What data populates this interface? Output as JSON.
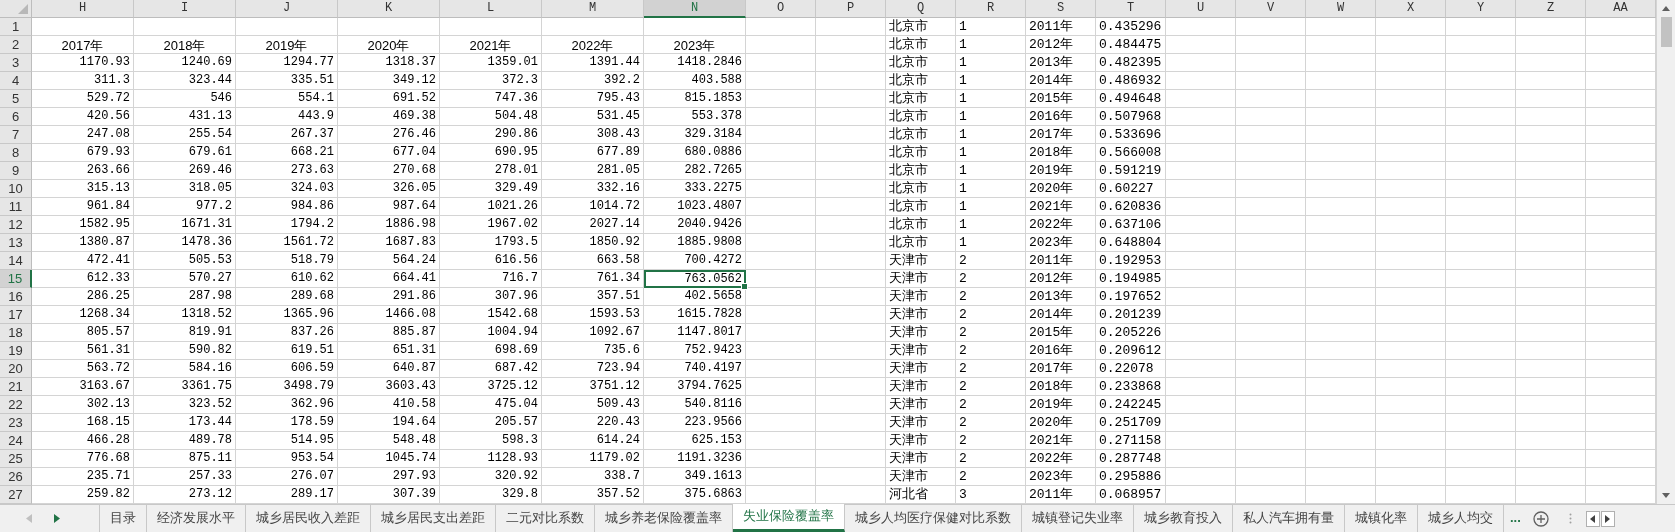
{
  "columns": [
    {
      "label": "H",
      "selected": false
    },
    {
      "label": "I",
      "selected": false
    },
    {
      "label": "J",
      "selected": false
    },
    {
      "label": "K",
      "selected": false
    },
    {
      "label": "L",
      "selected": false
    },
    {
      "label": "M",
      "selected": false
    },
    {
      "label": "N",
      "selected": true
    },
    {
      "label": "O",
      "selected": false
    },
    {
      "label": "P",
      "selected": false
    },
    {
      "label": "Q",
      "selected": false
    },
    {
      "label": "R",
      "selected": false
    },
    {
      "label": "S",
      "selected": false
    },
    {
      "label": "T",
      "selected": false
    },
    {
      "label": "U",
      "selected": false
    },
    {
      "label": "V",
      "selected": false
    },
    {
      "label": "W",
      "selected": false
    },
    {
      "label": "X",
      "selected": false
    },
    {
      "label": "Y",
      "selected": false
    },
    {
      "label": "Z",
      "selected": false
    },
    {
      "label": "AA",
      "selected": false
    }
  ],
  "rows": [
    {
      "number": "1",
      "selected": false,
      "right_cells": [
        "北京市",
        "1",
        "2011年",
        "0.435296"
      ]
    },
    {
      "number": "2",
      "selected": false,
      "kind": "label",
      "left_cells": [
        "2017年",
        "2018年",
        "2019年",
        "2020年",
        "2021年",
        "2022年",
        "2023年"
      ],
      "right_cells": [
        "北京市",
        "1",
        "2012年",
        "0.484475"
      ]
    },
    {
      "number": "3",
      "selected": false,
      "left_cells": [
        "1170.93",
        "1240.69",
        "1294.77",
        "1318.37",
        "1359.01",
        "1391.44",
        "1418.2846"
      ],
      "right_cells": [
        "北京市",
        "1",
        "2013年",
        "0.482395"
      ]
    },
    {
      "number": "4",
      "selected": false,
      "left_cells": [
        "311.3",
        "323.44",
        "335.51",
        "349.12",
        "372.3",
        "392.2",
        "403.588"
      ],
      "right_cells": [
        "北京市",
        "1",
        "2014年",
        "0.486932"
      ]
    },
    {
      "number": "5",
      "selected": false,
      "left_cells": [
        "529.72",
        "546",
        "554.1",
        "691.52",
        "747.36",
        "795.43",
        "815.1853"
      ],
      "right_cells": [
        "北京市",
        "1",
        "2015年",
        "0.494648"
      ]
    },
    {
      "number": "6",
      "selected": false,
      "left_cells": [
        "420.56",
        "431.13",
        "443.9",
        "469.38",
        "504.48",
        "531.45",
        "553.378"
      ],
      "right_cells": [
        "北京市",
        "1",
        "2016年",
        "0.507968"
      ]
    },
    {
      "number": "7",
      "selected": false,
      "left_cells": [
        "247.08",
        "255.54",
        "267.37",
        "276.46",
        "290.86",
        "308.43",
        "329.3184"
      ],
      "right_cells": [
        "北京市",
        "1",
        "2017年",
        "0.533696"
      ]
    },
    {
      "number": "8",
      "selected": false,
      "left_cells": [
        "679.93",
        "679.61",
        "668.21",
        "677.04",
        "690.95",
        "677.89",
        "680.0886"
      ],
      "right_cells": [
        "北京市",
        "1",
        "2018年",
        "0.566008"
      ]
    },
    {
      "number": "9",
      "selected": false,
      "left_cells": [
        "263.66",
        "269.46",
        "273.63",
        "270.68",
        "278.01",
        "281.05",
        "282.7265"
      ],
      "right_cells": [
        "北京市",
        "1",
        "2019年",
        "0.591219"
      ]
    },
    {
      "number": "10",
      "selected": false,
      "left_cells": [
        "315.13",
        "318.05",
        "324.03",
        "326.05",
        "329.49",
        "332.16",
        "333.2275"
      ],
      "right_cells": [
        "北京市",
        "1",
        "2020年",
        "0.60227"
      ]
    },
    {
      "number": "11",
      "selected": false,
      "left_cells": [
        "961.84",
        "977.2",
        "984.86",
        "987.64",
        "1021.26",
        "1014.72",
        "1023.4807"
      ],
      "right_cells": [
        "北京市",
        "1",
        "2021年",
        "0.620836"
      ]
    },
    {
      "number": "12",
      "selected": false,
      "left_cells": [
        "1582.95",
        "1671.31",
        "1794.2",
        "1886.98",
        "1967.02",
        "2027.14",
        "2040.9426"
      ],
      "right_cells": [
        "北京市",
        "1",
        "2022年",
        "0.637106"
      ]
    },
    {
      "number": "13",
      "selected": false,
      "left_cells": [
        "1380.87",
        "1478.36",
        "1561.72",
        "1687.83",
        "1793.5",
        "1850.92",
        "1885.9808"
      ],
      "right_cells": [
        "北京市",
        "1",
        "2023年",
        "0.648804"
      ]
    },
    {
      "number": "14",
      "selected": false,
      "left_cells": [
        "472.41",
        "505.53",
        "518.79",
        "564.24",
        "616.56",
        "663.58",
        "700.4272"
      ],
      "right_cells": [
        "天津市",
        "2",
        "2011年",
        "0.192953"
      ]
    },
    {
      "number": "15",
      "selected": true,
      "left_cells": [
        "612.33",
        "570.27",
        "610.62",
        "664.41",
        "716.7",
        "761.34",
        "763.0562"
      ],
      "right_cells": [
        "天津市",
        "2",
        "2012年",
        "0.194985"
      ]
    },
    {
      "number": "16",
      "selected": false,
      "left_cells": [
        "286.25",
        "287.98",
        "289.68",
        "291.86",
        "307.96",
        "357.51",
        "402.5658"
      ],
      "right_cells": [
        "天津市",
        "2",
        "2013年",
        "0.197652"
      ]
    },
    {
      "number": "17",
      "selected": false,
      "left_cells": [
        "1268.34",
        "1318.52",
        "1365.96",
        "1466.08",
        "1542.68",
        "1593.53",
        "1615.7828"
      ],
      "right_cells": [
        "天津市",
        "2",
        "2014年",
        "0.201239"
      ]
    },
    {
      "number": "18",
      "selected": false,
      "left_cells": [
        "805.57",
        "819.91",
        "837.26",
        "885.87",
        "1004.94",
        "1092.67",
        "1147.8017"
      ],
      "right_cells": [
        "天津市",
        "2",
        "2015年",
        "0.205226"
      ]
    },
    {
      "number": "19",
      "selected": false,
      "left_cells": [
        "561.31",
        "590.82",
        "619.51",
        "651.31",
        "698.69",
        "735.6",
        "752.9423"
      ],
      "right_cells": [
        "天津市",
        "2",
        "2016年",
        "0.209612"
      ]
    },
    {
      "number": "20",
      "selected": false,
      "left_cells": [
        "563.72",
        "584.16",
        "606.59",
        "640.87",
        "687.42",
        "723.94",
        "740.4197"
      ],
      "right_cells": [
        "天津市",
        "2",
        "2017年",
        "0.22078"
      ]
    },
    {
      "number": "21",
      "selected": false,
      "left_cells": [
        "3163.67",
        "3361.75",
        "3498.79",
        "3603.43",
        "3725.12",
        "3751.12",
        "3794.7625"
      ],
      "right_cells": [
        "天津市",
        "2",
        "2018年",
        "0.233868"
      ]
    },
    {
      "number": "22",
      "selected": false,
      "left_cells": [
        "302.13",
        "323.52",
        "362.96",
        "410.58",
        "475.04",
        "509.43",
        "540.8116"
      ],
      "right_cells": [
        "天津市",
        "2",
        "2019年",
        "0.242245"
      ]
    },
    {
      "number": "23",
      "selected": false,
      "left_cells": [
        "168.15",
        "173.44",
        "178.59",
        "194.64",
        "205.57",
        "220.43",
        "223.9566"
      ],
      "right_cells": [
        "天津市",
        "2",
        "2020年",
        "0.251709"
      ]
    },
    {
      "number": "24",
      "selected": false,
      "left_cells": [
        "466.28",
        "489.78",
        "514.95",
        "548.48",
        "598.3",
        "614.24",
        "625.153"
      ],
      "right_cells": [
        "天津市",
        "2",
        "2021年",
        "0.271158"
      ]
    },
    {
      "number": "25",
      "selected": false,
      "left_cells": [
        "776.68",
        "875.11",
        "953.54",
        "1045.74",
        "1128.93",
        "1179.02",
        "1191.3236"
      ],
      "right_cells": [
        "天津市",
        "2",
        "2022年",
        "0.287748"
      ]
    },
    {
      "number": "26",
      "selected": false,
      "left_cells": [
        "235.71",
        "257.33",
        "276.07",
        "297.93",
        "320.92",
        "338.7",
        "349.1613"
      ],
      "right_cells": [
        "天津市",
        "2",
        "2023年",
        "0.295886"
      ]
    },
    {
      "number": "27",
      "selected": false,
      "left_cells": [
        "259.82",
        "273.12",
        "289.17",
        "307.39",
        "329.8",
        "357.52",
        "375.6863"
      ],
      "right_cells": [
        "河北省",
        "3",
        "2011年",
        "0.068957"
      ]
    }
  ],
  "sheet_tabs": [
    {
      "label": "目录",
      "selected": false
    },
    {
      "label": "经济发展水平",
      "selected": false
    },
    {
      "label": "城乡居民收入差距",
      "selected": false
    },
    {
      "label": "城乡居民支出差距",
      "selected": false
    },
    {
      "label": "二元对比系数",
      "selected": false
    },
    {
      "label": "城乡养老保险覆盖率",
      "selected": false
    },
    {
      "label": "失业保险覆盖率",
      "selected": true
    },
    {
      "label": "城乡人均医疗保健对比系数",
      "selected": false
    },
    {
      "label": "城镇登记失业率",
      "selected": false
    },
    {
      "label": "城乡教育投入",
      "selected": false
    },
    {
      "label": "私人汽车拥有量",
      "selected": false
    },
    {
      "label": "城镇化率",
      "selected": false
    },
    {
      "label": "城乡人均交",
      "selected": false
    }
  ],
  "more_tabs": "..."
}
